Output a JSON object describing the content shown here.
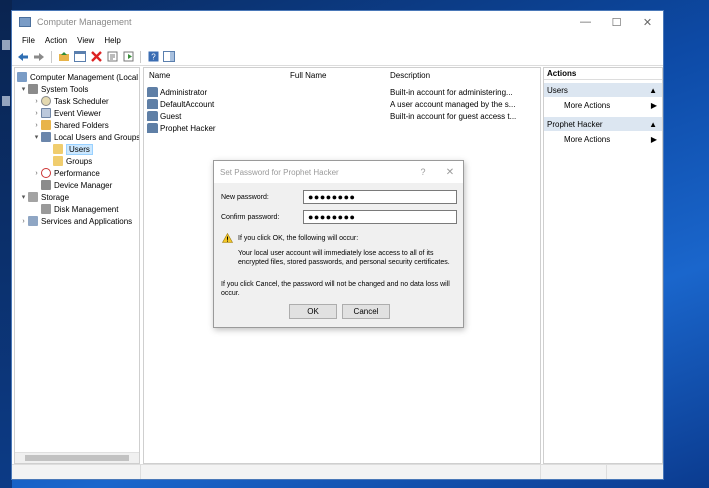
{
  "window": {
    "title": "Computer Management",
    "caption_minimize": "—",
    "caption_maximize": "☐",
    "caption_close": "✕"
  },
  "menu": [
    "File",
    "Action",
    "View",
    "Help"
  ],
  "tree": {
    "root": "Computer Management (Local",
    "system_tools": "System Tools",
    "task_scheduler": "Task Scheduler",
    "event_viewer": "Event Viewer",
    "shared_folders": "Shared Folders",
    "local_users_groups": "Local Users and Groups",
    "users": "Users",
    "groups": "Groups",
    "performance": "Performance",
    "device_manager": "Device Manager",
    "storage": "Storage",
    "disk_management": "Disk Management",
    "services_apps": "Services and Applications"
  },
  "list": {
    "columns": [
      "Name",
      "Full Name",
      "Description"
    ],
    "rows": [
      {
        "name": "Administrator",
        "full_name": "",
        "description": "Built-in account for administering..."
      },
      {
        "name": "DefaultAccount",
        "full_name": "",
        "description": "A user account managed by the s..."
      },
      {
        "name": "Guest",
        "full_name": "",
        "description": "Built-in account for guest access t..."
      },
      {
        "name": "Prophet Hacker",
        "full_name": "",
        "description": ""
      }
    ]
  },
  "actions": {
    "header": "Actions",
    "section1": "Users",
    "section1_item": "More Actions",
    "section2": "Prophet Hacker",
    "section2_item": "More Actions"
  },
  "dialog": {
    "title": "Set Password for Prophet Hacker",
    "help": "?",
    "close": "✕",
    "new_password_label": "New password:",
    "new_password_value": "●●●●●●●●",
    "confirm_password_label": "Confirm password:",
    "confirm_password_value": "●●●●●●●●",
    "warning_heading": "If you click OK, the following will occur:",
    "warning_body_line1": "Your local user account will immediately lose access to all of its",
    "warning_body_line2": "encrypted files, stored passwords, and personal security certificates.",
    "cancel_note_line1": "If you click Cancel, the password will not be changed and no data loss will",
    "cancel_note_line2": "occur.",
    "ok_label": "OK",
    "cancel_label": "Cancel"
  }
}
